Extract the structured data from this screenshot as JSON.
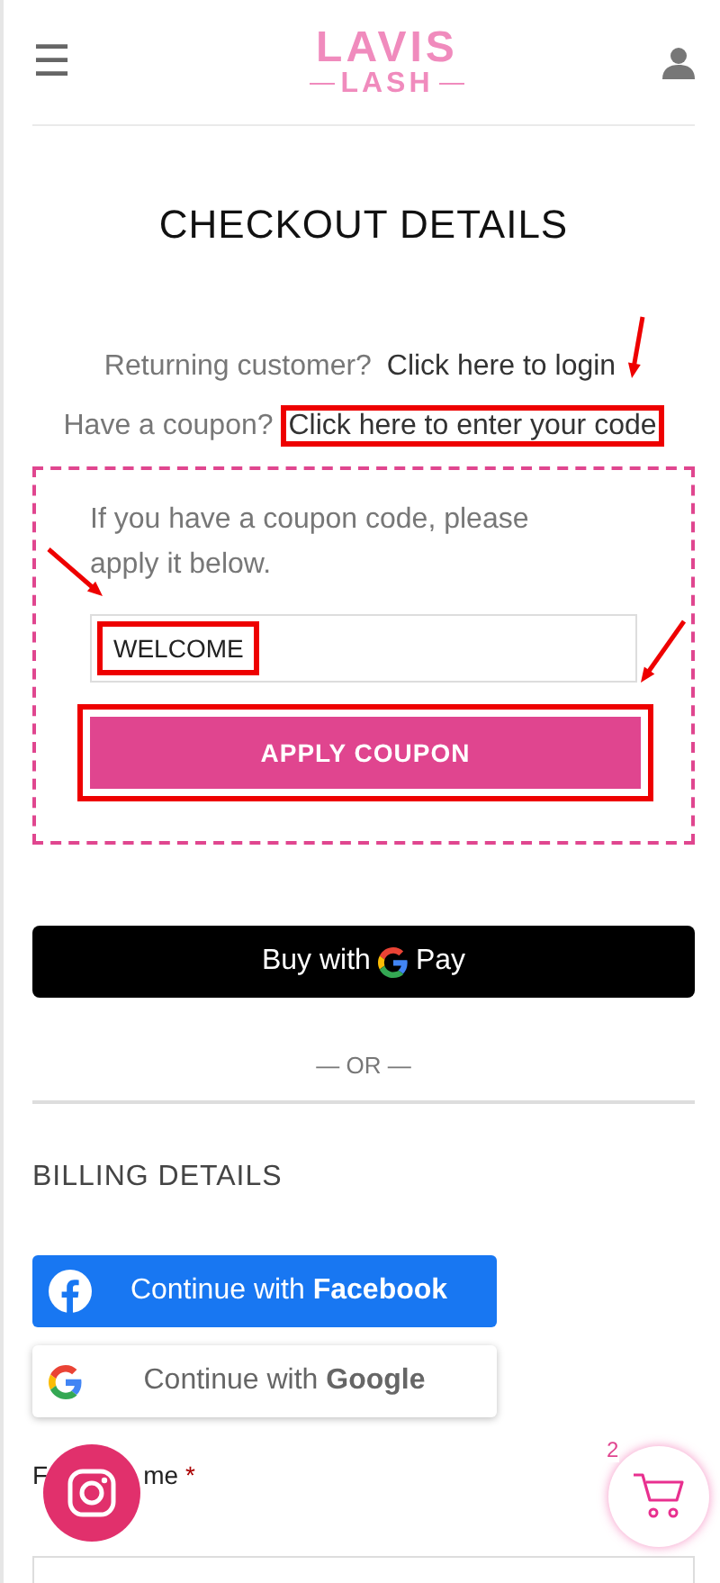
{
  "header": {
    "menu_icon": "☰",
    "logo": {
      "line_1": "LAVIS",
      "line_2": "LASH"
    }
  },
  "title": "CHECKOUT DETAILS",
  "notices": [
    {
      "prompt": "Returning customer?",
      "link": "Click here to login",
      "highlighted": false
    },
    {
      "prompt": "Have a coupon?",
      "link": "Click here to enter your code",
      "highlighted": true
    }
  ],
  "coupon": {
    "text": "If you have a coupon code, please apply it below.",
    "value": "WELCOME",
    "value_highlighted": true,
    "button": "APPLY COUPON",
    "button_highlighted": true
  },
  "gpay": {
    "prefix": "Buy with",
    "suffix": "Pay"
  },
  "separator": "— OR —",
  "billing": {
    "heading": "BILLING DETAILS",
    "social": [
      {
        "kind": "facebook",
        "prefix": "Continue with",
        "brand": "Facebook"
      },
      {
        "kind": "google",
        "prefix": "Continue with",
        "brand": "Google"
      }
    ],
    "field_label": {
      "start": "F",
      "end": "me",
      "required": "*"
    }
  },
  "cart": {
    "count": "2"
  }
}
